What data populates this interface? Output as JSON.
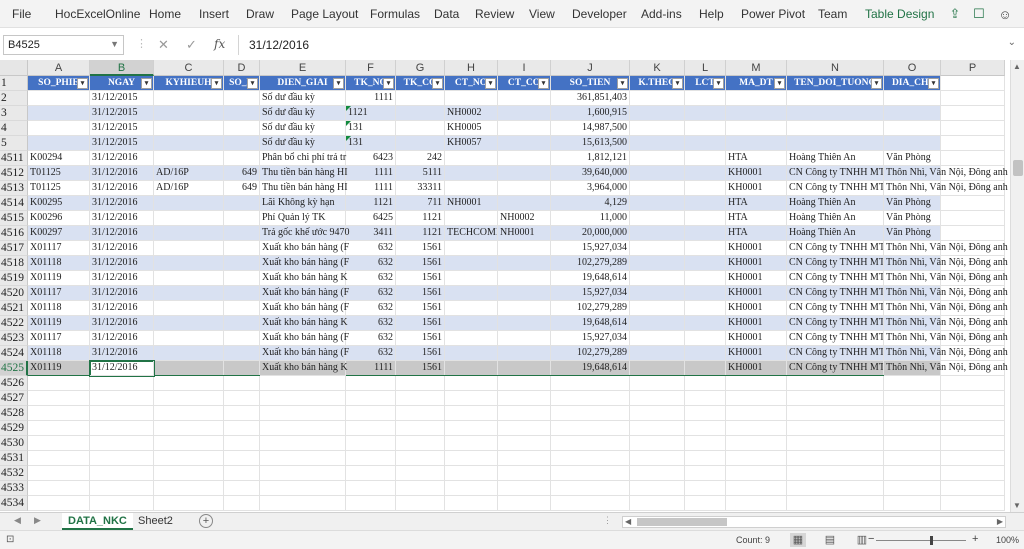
{
  "ribbon": {
    "menu": [
      {
        "label": "File"
      },
      {
        "label": "HocExcelOnline"
      },
      {
        "label": "Home"
      },
      {
        "label": "Insert"
      },
      {
        "label": "Draw"
      },
      {
        "label": "Page Layout"
      },
      {
        "label": "Formulas"
      },
      {
        "label": "Data"
      },
      {
        "label": "Review"
      },
      {
        "label": "View"
      },
      {
        "label": "Developer"
      },
      {
        "label": "Add-ins"
      },
      {
        "label": "Help"
      },
      {
        "label": "Power Pivot"
      },
      {
        "label": "Team"
      },
      {
        "label": "Table Design"
      }
    ],
    "accent": "#217346",
    "icons": [
      "share-icon",
      "comment-icon",
      "smiley-icon"
    ]
  },
  "formula_bar": {
    "name_box": "B4525",
    "formula": "31/12/2016",
    "fx_label": "fx"
  },
  "columns": [
    "A",
    "B",
    "C",
    "D",
    "E",
    "F",
    "G",
    "H",
    "I",
    "J",
    "K",
    "L",
    "M",
    "N",
    "O",
    "P"
  ],
  "selected_column": "B",
  "table": {
    "header_row": "1",
    "headers": [
      "SO_PHIE",
      "NGAY",
      "KYHIEUH",
      "SO_H",
      "DIEN_GIAI",
      "TK_NO",
      "TK_CO",
      "CT_NO",
      "CT_CO",
      "SO_TIEN",
      "K.THEO",
      "LCT",
      "MA_DT",
      "TEN_DOI_TUONG",
      "DIA_CHI"
    ],
    "header_color": "#4472c4",
    "band_color": "#d9e1f2"
  },
  "rows": [
    {
      "num": "2",
      "cells": [
        "",
        "31/12/2015",
        "",
        "",
        "Số dư đầu kỳ",
        "1111",
        "",
        "",
        "",
        "361,851,403",
        "",
        "",
        "",
        "",
        ""
      ]
    },
    {
      "num": "3",
      "cells": [
        "",
        "31/12/2015",
        "",
        "",
        "Số dư đầu kỳ",
        "1121",
        "",
        "NH0002",
        "",
        "1,600,915",
        "",
        "",
        "",
        "",
        ""
      ]
    },
    {
      "num": "4",
      "cells": [
        "",
        "31/12/2015",
        "",
        "",
        "Số dư đầu kỳ",
        "131",
        "",
        "KH0005",
        "",
        "14,987,500",
        "",
        "",
        "",
        "",
        ""
      ]
    },
    {
      "num": "5",
      "cells": [
        "",
        "31/12/2015",
        "",
        "",
        "Số dư đầu kỳ",
        "131",
        "",
        "KH0057",
        "",
        "15,613,500",
        "",
        "",
        "",
        "",
        ""
      ]
    },
    {
      "num": "4511",
      "cells": [
        "K00294",
        "31/12/2016",
        "",
        "",
        "Phân bổ chi phí trả tr",
        "6423",
        "242",
        "",
        "",
        "1,812,121",
        "",
        "",
        "HTA",
        "Hoàng Thiên An",
        "Văn Phòng"
      ]
    },
    {
      "num": "4512",
      "cells": [
        "T01125",
        "31/12/2016",
        "AD/16P",
        "649",
        "Thu tiền bán hàng HI",
        "1111",
        "5111",
        "",
        "",
        "39,640,000",
        "",
        "",
        "KH0001",
        "CN Công ty TNHH MT",
        "Thôn Nhì, Vân Nội, Đông anh"
      ]
    },
    {
      "num": "4513",
      "cells": [
        "T01125",
        "31/12/2016",
        "AD/16P",
        "649",
        "Thu tiền bán hàng HI",
        "1111",
        "33311",
        "",
        "",
        "3,964,000",
        "",
        "",
        "KH0001",
        "CN Công ty TNHH MT",
        "Thôn Nhì, Vân Nội, Đông anh"
      ]
    },
    {
      "num": "4514",
      "cells": [
        "K00295",
        "31/12/2016",
        "",
        "",
        "Lãi Không kỳ hạn",
        "1121",
        "711",
        "NH0001",
        "",
        "4,129",
        "",
        "",
        "HTA",
        "Hoàng Thiên An",
        "Văn Phòng"
      ]
    },
    {
      "num": "4515",
      "cells": [
        "K00296",
        "31/12/2016",
        "",
        "",
        "Phí Quản lý TK",
        "6425",
        "1121",
        "",
        "NH0002",
        "11,000",
        "",
        "",
        "HTA",
        "Hoàng Thiên An",
        "Văn Phòng"
      ]
    },
    {
      "num": "4516",
      "cells": [
        "K00297",
        "31/12/2016",
        "",
        "",
        "Trả gốc khế ước 9470",
        "3411",
        "1121",
        "TECHCOMI",
        "NH0001",
        "20,000,000",
        "",
        "",
        "HTA",
        "Hoàng Thiên An",
        "Văn Phòng"
      ]
    },
    {
      "num": "4517",
      "cells": [
        "X01117",
        "31/12/2016",
        "",
        "",
        "Xuất kho bán hàng (F",
        "632",
        "1561",
        "",
        "",
        "15,927,034",
        "",
        "",
        "KH0001",
        "CN Công ty TNHH MT",
        "Thôn Nhì, Vân Nội, Đông anh"
      ]
    },
    {
      "num": "4518",
      "cells": [
        "X01118",
        "31/12/2016",
        "",
        "",
        "Xuất kho bán hàng (F",
        "632",
        "1561",
        "",
        "",
        "102,279,289",
        "",
        "",
        "KH0001",
        "CN Công ty TNHH MT",
        "Thôn Nhì, Vân Nội, Đông anh"
      ]
    },
    {
      "num": "4519",
      "cells": [
        "X01119",
        "31/12/2016",
        "",
        "",
        "Xuất kho bán hàng K",
        "632",
        "1561",
        "",
        "",
        "19,648,614",
        "",
        "",
        "KH0001",
        "CN Công ty TNHH MT",
        "Thôn Nhì, Vân Nội, Đông anh"
      ]
    },
    {
      "num": "4520",
      "cells": [
        "X01117",
        "31/12/2016",
        "",
        "",
        "Xuất kho bán hàng (F",
        "632",
        "1561",
        "",
        "",
        "15,927,034",
        "",
        "",
        "KH0001",
        "CN Công ty TNHH MT",
        "Thôn Nhì, Vân Nội, Đông anh"
      ]
    },
    {
      "num": "4521",
      "cells": [
        "X01118",
        "31/12/2016",
        "",
        "",
        "Xuất kho bán hàng (F",
        "632",
        "1561",
        "",
        "",
        "102,279,289",
        "",
        "",
        "KH0001",
        "CN Công ty TNHH MT",
        "Thôn Nhì, Vân Nội, Đông anh"
      ]
    },
    {
      "num": "4522",
      "cells": [
        "X01119",
        "31/12/2016",
        "",
        "",
        "Xuất kho bán hàng K",
        "632",
        "1561",
        "",
        "",
        "19,648,614",
        "",
        "",
        "KH0001",
        "CN Công ty TNHH MT",
        "Thôn Nhì, Vân Nội, Đông anh"
      ]
    },
    {
      "num": "4523",
      "cells": [
        "X01117",
        "31/12/2016",
        "",
        "",
        "Xuất kho bán hàng (F",
        "632",
        "1561",
        "",
        "",
        "15,927,034",
        "",
        "",
        "KH0001",
        "CN Công ty TNHH MT",
        "Thôn Nhì, Vân Nội, Đông anh"
      ]
    },
    {
      "num": "4524",
      "cells": [
        "X01118",
        "31/12/2016",
        "",
        "",
        "Xuất kho bán hàng (F",
        "632",
        "1561",
        "",
        "",
        "102,279,289",
        "",
        "",
        "KH0001",
        "CN Công ty TNHH MT",
        "Thôn Nhì, Vân Nội, Đông anh"
      ]
    },
    {
      "num": "4525",
      "cells": [
        "X01119",
        "31/12/2016",
        "",
        "",
        "Xuất kho bán hàng K",
        "1111",
        "1561",
        "",
        "",
        "19,648,614",
        "",
        "",
        "KH0001",
        "CN Công ty TNHH MT",
        "Thôn Nhì, Vân Nội, Đông anh"
      ]
    }
  ],
  "selected_row": "4525",
  "empty_rows": [
    "4526",
    "4527",
    "4528",
    "4529",
    "4530",
    "4531",
    "4532",
    "4533",
    "4534"
  ],
  "sheets": {
    "tabs": [
      "DATA_NKC",
      "Sheet2"
    ],
    "active": "DATA_NKC"
  },
  "status": {
    "count": "Count: 9",
    "zoom": "100%"
  }
}
